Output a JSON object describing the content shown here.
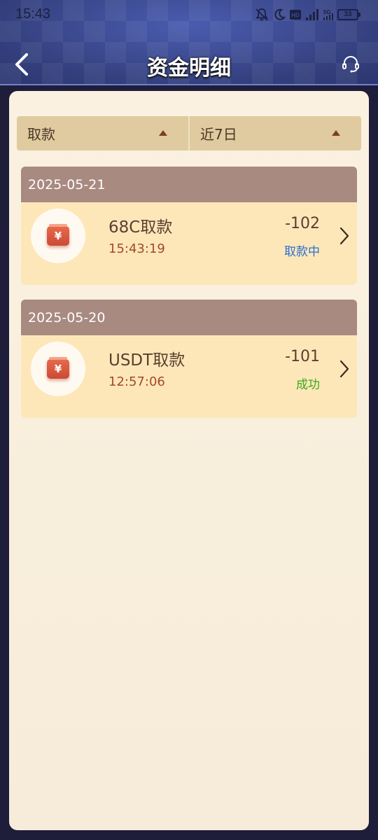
{
  "status_bar": {
    "time": "15:43",
    "battery": "33"
  },
  "nav": {
    "title": "资金明细"
  },
  "filters": [
    {
      "label": "取款"
    },
    {
      "label": "近7日"
    }
  ],
  "groups": [
    {
      "date": "2025-05-21",
      "records": [
        {
          "title": "68C取款",
          "time": "15:43:19",
          "amount": "-102",
          "status": "取款中",
          "status_color": "#2a6fcf"
        }
      ]
    },
    {
      "date": "2025-05-20",
      "records": [
        {
          "title": "USDT取款",
          "time": "12:57:06",
          "amount": "-101",
          "status": "成功",
          "status_color": "#3aa81e"
        }
      ]
    }
  ],
  "icons": {
    "record_icon": "wallet-yuan-icon",
    "currency_symbol": "¥"
  }
}
